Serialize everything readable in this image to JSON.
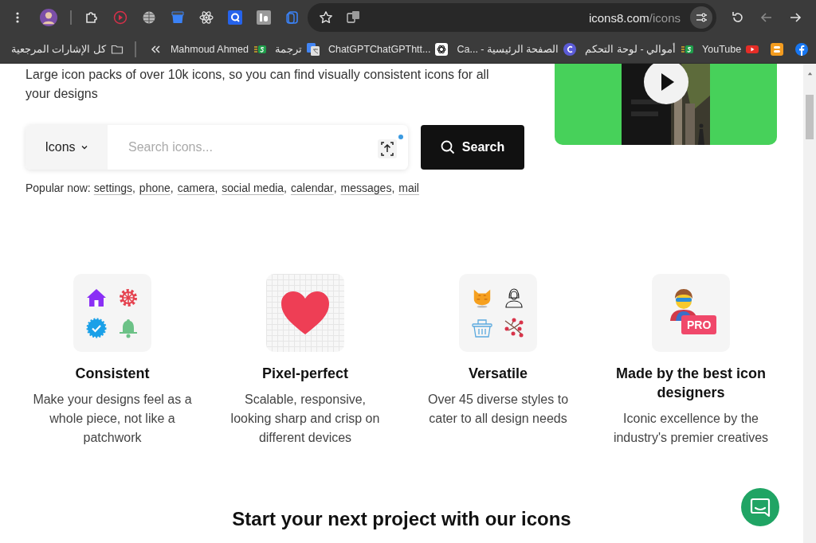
{
  "browser": {
    "url_host": "icons8.com",
    "url_path": "/icons"
  },
  "bookmarks_bar": {
    "all_bookmarks": "كل الإشارات المرجعية",
    "items": [
      {
        "label": "Mahmoud Ahmed"
      },
      {
        "label": "ترجمة"
      },
      {
        "label": "ChatGPTChatGPThtt..."
      },
      {
        "label": "Ca... - الصفحة الرئيسية"
      },
      {
        "label": "أموالي - لوحة التحكم"
      },
      {
        "label": "YouTube"
      }
    ]
  },
  "intro": "Large icon packs of over 10k icons, so you can find visually consistent icons for all your designs",
  "search": {
    "category": "Icons",
    "placeholder": "Search icons...",
    "button": "Search"
  },
  "popular": {
    "label": "Popular now:",
    "links": [
      {
        "text": "settings",
        "after": ","
      },
      {
        "text": "phone",
        "after": ","
      },
      {
        "text": "camera",
        "after": ","
      },
      {
        "text": "social media",
        "after": ","
      },
      {
        "text": "calendar",
        "after": ","
      },
      {
        "text": "messages",
        "after": ","
      },
      {
        "text": "mail"
      }
    ]
  },
  "features": [
    {
      "title": "Consistent",
      "description": "Make your designs feel as a whole piece, not like a patchwork"
    },
    {
      "title": "Pixel-perfect",
      "description": "Scalable, responsive, looking sharp and crisp on different devices"
    },
    {
      "title": "Versatile",
      "description": "Over 45 diverse styles to cater to all design needs"
    },
    {
      "title": "Made by the best icon designers",
      "description": "Iconic excellence by the industry's premier creatives",
      "badge": "PRO"
    }
  ],
  "cta_heading": "Start your next project with our icons"
}
